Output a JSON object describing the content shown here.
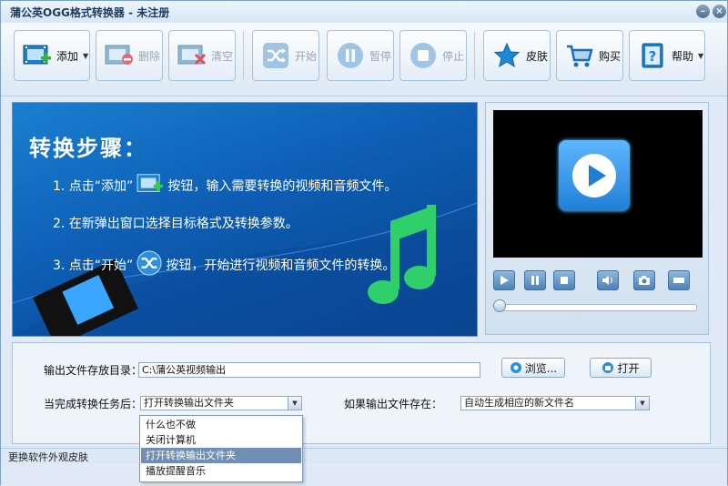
{
  "window": {
    "title": "蒲公英OGG格式转换器 - 未注册"
  },
  "toolbar": {
    "add": "添加",
    "delete": "删除",
    "clear": "清空",
    "start": "开始",
    "pause": "暂停",
    "stop": "停止",
    "skin": "皮肤",
    "buy": "购买",
    "help": "帮助"
  },
  "banner": {
    "heading": "转换步骤：",
    "step1_pre": "1. 点击“添加”",
    "step1_post": "按钮，输入需要转换的视频和音频文件。",
    "step2": "2. 在新弹出窗口选择目标格式及转换参数。",
    "step3_pre": "3. 点击“开始”",
    "step3_post": "按钮，开始进行视频和音频文件的转换。"
  },
  "settings": {
    "output_dir_label": "输出文件存放目录：",
    "output_dir_value": "C:\\蒲公英视频输出",
    "browse": "浏览...",
    "open": "打开",
    "after_label": "当完成转换任务后：",
    "after_value": "打开转换输出文件夹",
    "exists_label": "如果输出文件存在：",
    "exists_value": "自动生成相应的新文件名"
  },
  "after_options": [
    "什么也不做",
    "关闭计算机",
    "打开转换输出文件夹",
    "播放提醒音乐"
  ],
  "selected_option_index": 2,
  "statusbar": {
    "text": "更换软件外观皮肤"
  }
}
